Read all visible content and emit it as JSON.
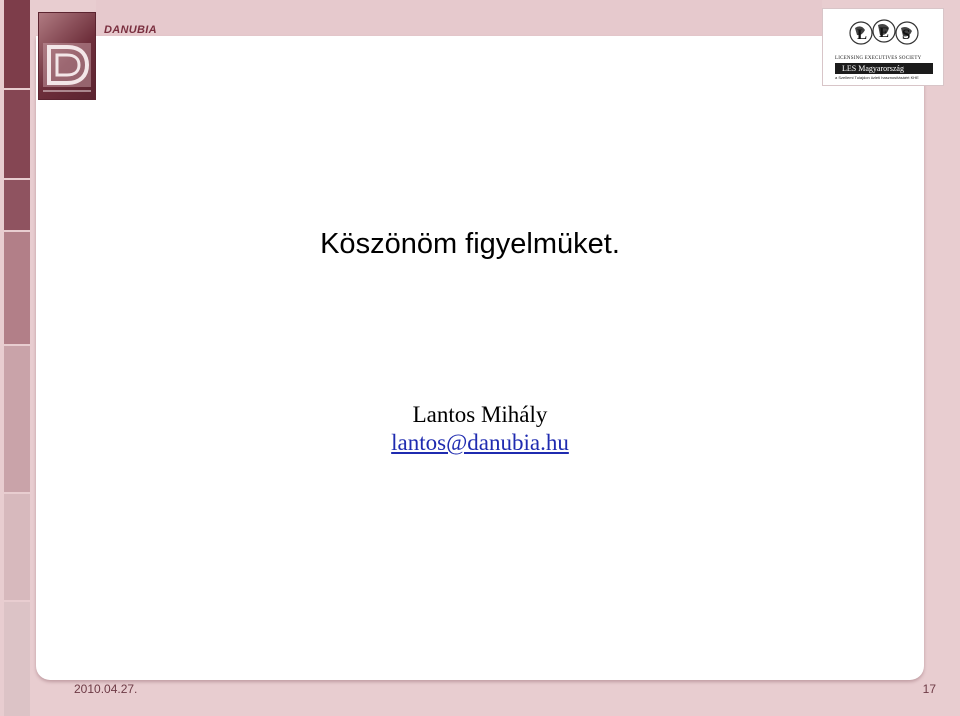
{
  "header": {
    "brand": "DANUBIA",
    "partner_logo": {
      "society": "LICENSING EXECUTIVES SOCIETY",
      "bar": "LES Magyarország",
      "subtitle": "a Szellemi Tulajdon üzleti hasznosításáért KHE"
    }
  },
  "slide": {
    "title": "Köszönöm figyelmüket.",
    "author": "Lantos Mihály",
    "email": "lantos@danubia.hu"
  },
  "footer": {
    "date": "2010.04.27.",
    "page_number": "17"
  },
  "colors": {
    "accent": "#7a2f3f",
    "link": "#1f2bb0",
    "background": "#e8cdd0"
  }
}
